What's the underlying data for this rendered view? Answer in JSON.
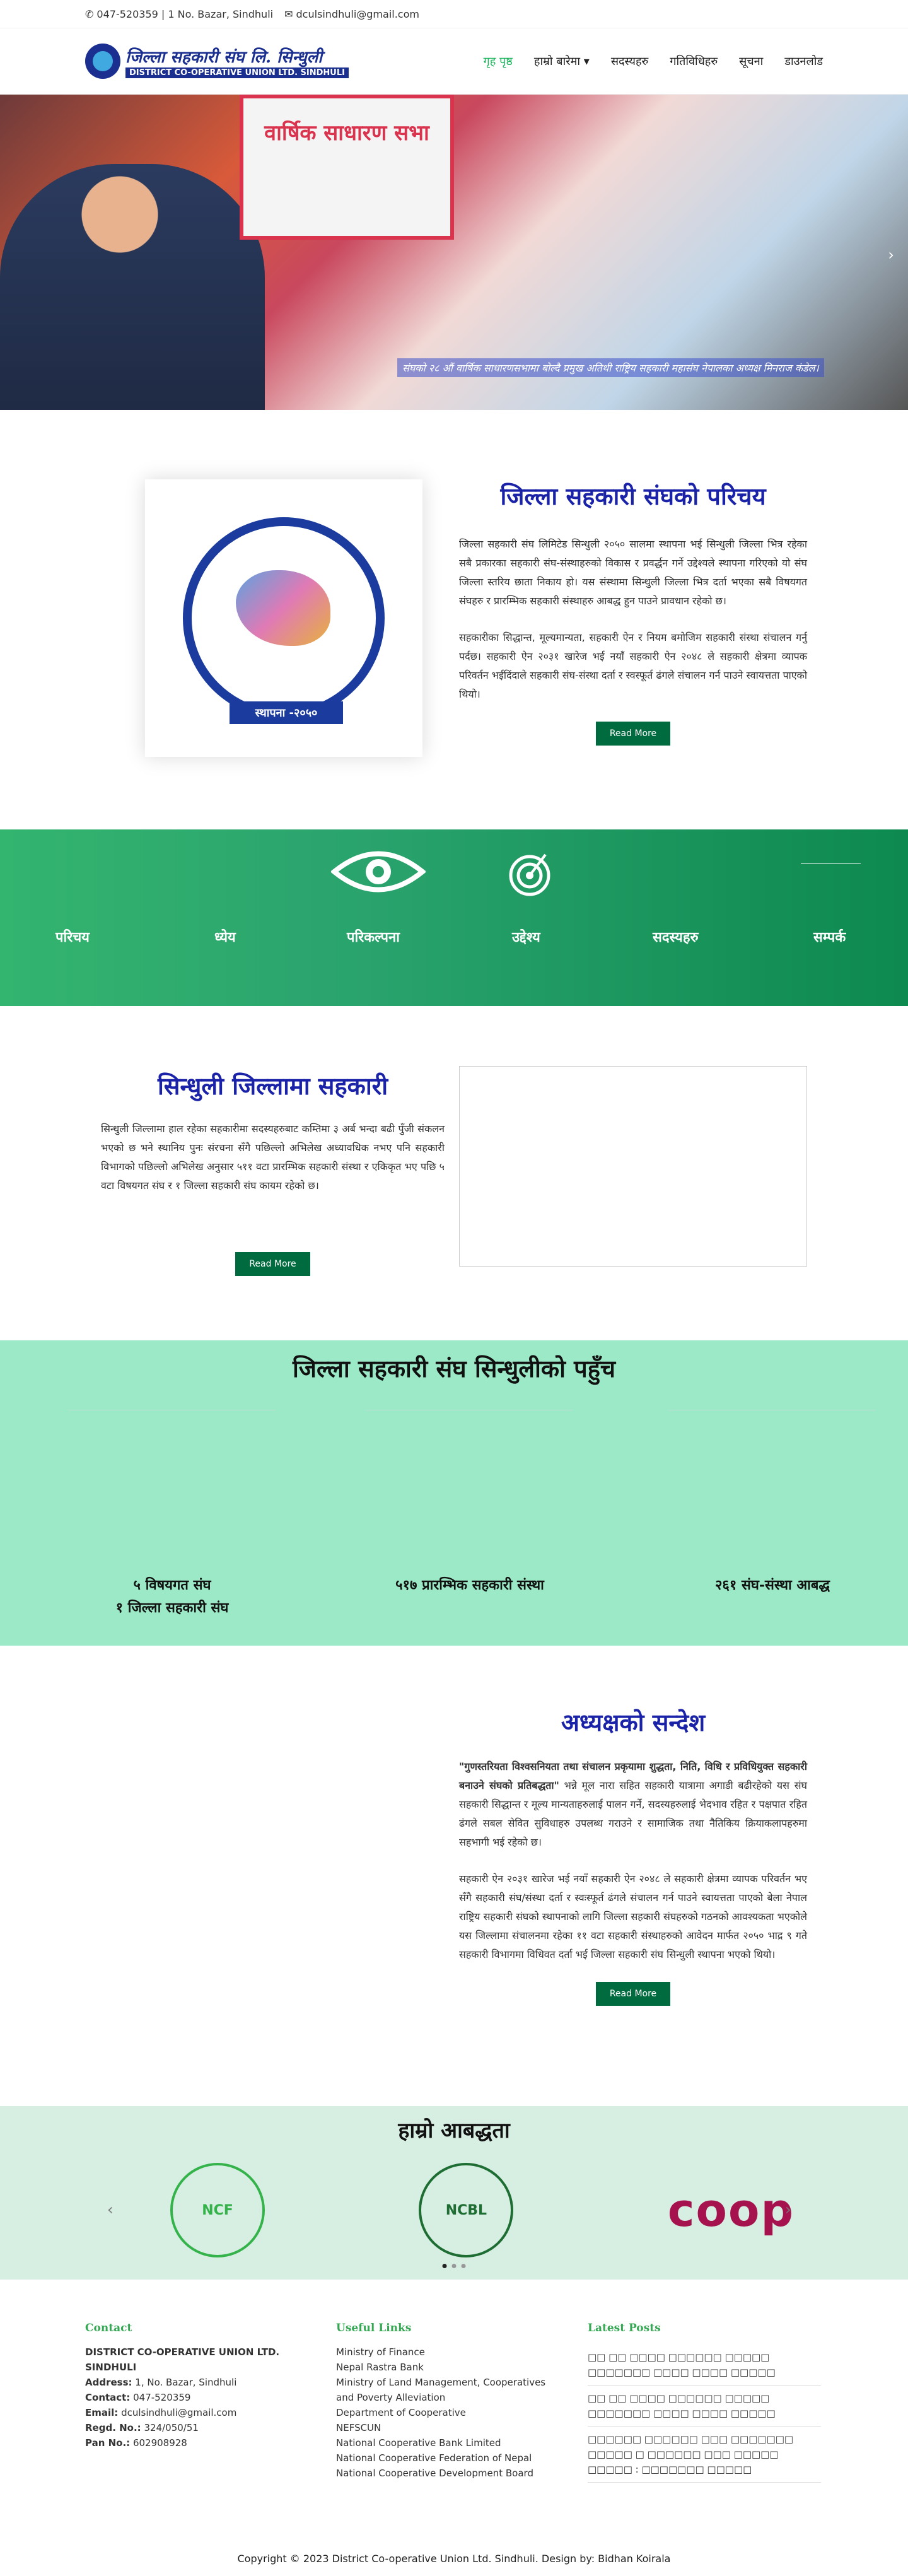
{
  "topbar": {
    "phone": "047-520359 | 1 No. Bazar, Sindhuli",
    "email": "dculsindhuli@gmail.com"
  },
  "header": {
    "logo_title": "जिल्ला सहकारी संघ लि. सिन्धुली",
    "logo_sub": "DISTRICT CO-OPERATIVE UNION LTD. SINDHULI"
  },
  "nav": {
    "home": "गृह पृष्ठ",
    "about": "हाम्रो बारेमा",
    "members": "सदस्यहरु",
    "activities": "गतिविधिहरु",
    "notice": "सूचना",
    "download": "डाउनलोड"
  },
  "hero": {
    "banner": "वार्षिक साधारण सभा",
    "caption": "संघको २८ औं वार्षिक साधारणसभामा बोल्दै प्रमुख अतिथी राष्ट्रिय सहकारी महासंघ नेपालका अध्यक्ष मिनराज कंडेल।"
  },
  "intro": {
    "title": "जिल्ला सहकारी संघको परिचय",
    "para1": "जिल्ला सहकारी संघ लिमिटेड सिन्धुली २०५० सालमा स्थापना भई सिन्धुली जिल्ला भित्र रहेका सबै प्रकारका सहकारी संघ-संस्थाहरुको विकास र प्रवर्द्धन गर्ने उद्देश्यले स्थापना गरिएको यो संघ जिल्ला स्तरिय छाता निकाय हो। यस संस्थामा सिन्धुली जिल्ला भित्र दर्ता भएका सबै विषयगत संघहरु र प्रारम्भिक सहकारी संस्थाहरु आबद्ध हुन पाउने प्रावधान रहेको छ।",
    "para2": "सहकारीका सिद्धान्त, मूल्यमान्यता, सहकारी ऐन र नियम बमोजिम सहकारी संस्था संचालन गर्नु पर्दछ। सहकारी ऐन २०३१ खारेज भई नयाँ सहकारी ऐन २०४८ ले सहकारी क्षेत्रमा व्यापक परिवर्तन भईदिंदाले सहकारी संघ-संस्था दर्ता र स्वस्फूर्त ढंगले संचालन गर्न पाउने स्वायत्तता पाएको थियो।",
    "seal_text": "स्थापना -२०५०",
    "button": "Read More"
  },
  "strip": {
    "items": [
      "परिचय",
      "ध्येय",
      "परिकल्पना",
      "उद्देश्य",
      "सदस्यहरु",
      "सम्पर्क"
    ]
  },
  "coop": {
    "title": "सिन्धुली जिल्लामा सहकारी",
    "para": "सिन्धुली जिल्लामा हाल रहेका सहकारीमा सदस्यहरुबाट कम्तिमा ३ अर्ब भन्दा बढी पुँजी संकलन भएको छ भने स्थानिय पुनः संरचना सँगै पछिल्लो अभिलेख अध्यावधिक नभए पनि सहकारी विभागको पछिल्लो अभिलेख अनुसार ५११ वटा प्रारम्भिक सहकारी संस्था र एकिकृत भए पछि ५ वटा विषयगत संघ र १ जिल्ला सहकारी संघ कायम रहेको छ।",
    "button": "Read More"
  },
  "reach": {
    "title": "जिल्ला सहकारी संघ सिन्धुलीको पहुँच",
    "c1a": "५ विषयगत संघ",
    "c1b": "१ जिल्ला सहकारी संघ",
    "c2": "५१७ प्रारम्भिक सहकारी संस्था",
    "c3": "२६१ संघ-संस्था आबद्ध"
  },
  "msg": {
    "title": "अध्यक्षको सन्देश",
    "quote": "\"गुणस्तरियता विश्वसनियता तथा संचालन प्रकृयामा शुद्धता, निति, विधि र प्रविधियुक्त सहकारी बनाउने संघको प्रतिबद्धता\"",
    "p1": " भन्ने मूल नारा सहित सहकारी यात्रामा अगाडी बढीरहेको यस संघ सहकारी सिद्धान्त र मूल्य मान्यताहरुलाई पालन गर्ने, सदस्यहरुलाई भेदभाव रहित र पक्षपात रहित ढंगले सबल सेवित सुविधाहरु उपलब्ध गराउने र सामाजिक तथा नैतिकिय क्रियाकलापहरुमा सहभागी भई रहेको छ।",
    "p2": "सहकारी ऐन २०३१ खारेज भई नयाँ सहकारी ऐन २०४८ ले सहकारी क्षेत्रमा व्यापक परिवर्तन भए सँगै सहकारी संघ/संस्था दर्ता र स्वःस्फूर्त ढंगले संचालन गर्न पाउने स्वायत्तता पाएको बेला नेपाल राष्ट्रिय सहकारी संघको स्थापनाको लागि जिल्ला सहकारी संघहरुको गठनको आवश्यकता भएकोले यस जिल्लामा संचालनमा रहेका ११ वटा सहकारी संस्थाहरुको आवेदन मार्फत २०५० भाद्र ९ गते सहकारी विभागमा विधिवत दर्ता भई जिल्ला सहकारी संघ सिन्धुली स्थापना भएको थियो।",
    "button": "Read More"
  },
  "aff": {
    "title": "हाम्रो आबद्धता",
    "l1": "NCF",
    "l2": "NCBL",
    "l3": "coop"
  },
  "footer": {
    "contact_h": "Contact",
    "org": "DISTRICT CO-OPERATIVE UNION LTD. SINDHULI",
    "addr_l": "Address:",
    "addr": "1, No. Bazar, Sindhuli",
    "contact_l": "Contact:",
    "contact": "047-520359",
    "email_l": "Email:",
    "email": "dculsindhuli@gmail.com",
    "regd_l": "Regd. No.:",
    "regd": "324/050/51",
    "pan_l": "Pan No.:",
    "pan": "602908928",
    "links_h": "Useful Links",
    "links": [
      "Ministry of Finance",
      "Nepal Rastra Bank",
      "Ministry of Land Management, Cooperatives and Poverty Alleviation",
      "Department of Cooperative",
      "NEFSCUN",
      "National Cooperative Bank Limited",
      "National Cooperative Federation of Nepal",
      "National Cooperative Development Board"
    ],
    "posts_h": "Latest Posts",
    "posts": [
      "□□ □□ □□□□ □□□□□□ □□□□□ □□□□□□□ □□□□ □□□□ □□□□□",
      "□□ □□ □□□□ □□□□□□ □□□□□ □□□□□□□ □□□□ □□□□ □□□□□",
      "□□□□□□ □□□□□□ □□□ □□□□□□□ □□□□□ □ □□□□□□ □□□ □□□□□ □□□□□ : □□□□□□□ □□□□□"
    ],
    "copyright": "Copyright © 2023 District Co-operative Union Ltd. Sindhuli. Design by: Bidhan Koirala"
  }
}
